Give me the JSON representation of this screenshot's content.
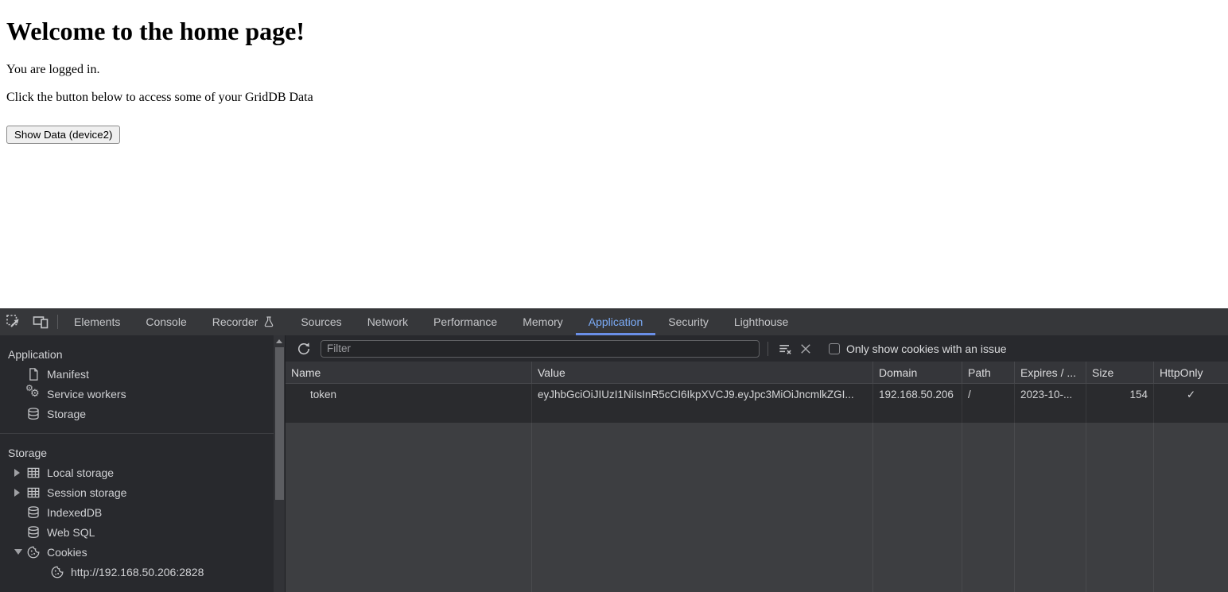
{
  "page": {
    "heading": "Welcome to the home page!",
    "paragraph1": "You are logged in.",
    "paragraph2": "Click the button below to access some of your GridDB Data",
    "show_data_button": "Show Data (device2)"
  },
  "devtools": {
    "tabs": [
      "Elements",
      "Console",
      "Recorder",
      "Sources",
      "Network",
      "Performance",
      "Memory",
      "Application",
      "Security",
      "Lighthouse"
    ],
    "active_tab": "Application",
    "sidebar": {
      "sections": [
        {
          "title": "Application",
          "items": [
            {
              "label": "Manifest"
            },
            {
              "label": "Service workers"
            },
            {
              "label": "Storage"
            }
          ]
        },
        {
          "title": "Storage",
          "items": [
            {
              "label": "Local storage"
            },
            {
              "label": "Session storage"
            },
            {
              "label": "IndexedDB"
            },
            {
              "label": "Web SQL"
            },
            {
              "label": "Cookies"
            },
            {
              "label": "http://192.168.50.206:2828"
            }
          ]
        }
      ]
    },
    "toolbar": {
      "filter_placeholder": "Filter",
      "checkbox_label": "Only show cookies with an issue"
    },
    "cookies_table": {
      "columns": [
        "Name",
        "Value",
        "Domain",
        "Path",
        "Expires / ...",
        "Size",
        "HttpOnly"
      ],
      "row": {
        "name": "token",
        "value": "eyJhbGciOiJIUzI1NiIsInR5cCI6IkpXVCJ9.eyJpc3MiOiJncmlkZGI...",
        "domain": "192.168.50.206",
        "path": "/",
        "expires": "2023-10-...",
        "size": "154",
        "httponly": "✓"
      }
    },
    "colors": {
      "accent_blue": "#7cacf8",
      "tab_underline": "#6a8fe8",
      "tabbar_bg": "#36373a",
      "panel_bg": "#28292d",
      "grid_header_bg": "#35363a",
      "grid_row_bg": "#2a2b2e",
      "grid_filler_bg": "#3d3e41"
    }
  }
}
